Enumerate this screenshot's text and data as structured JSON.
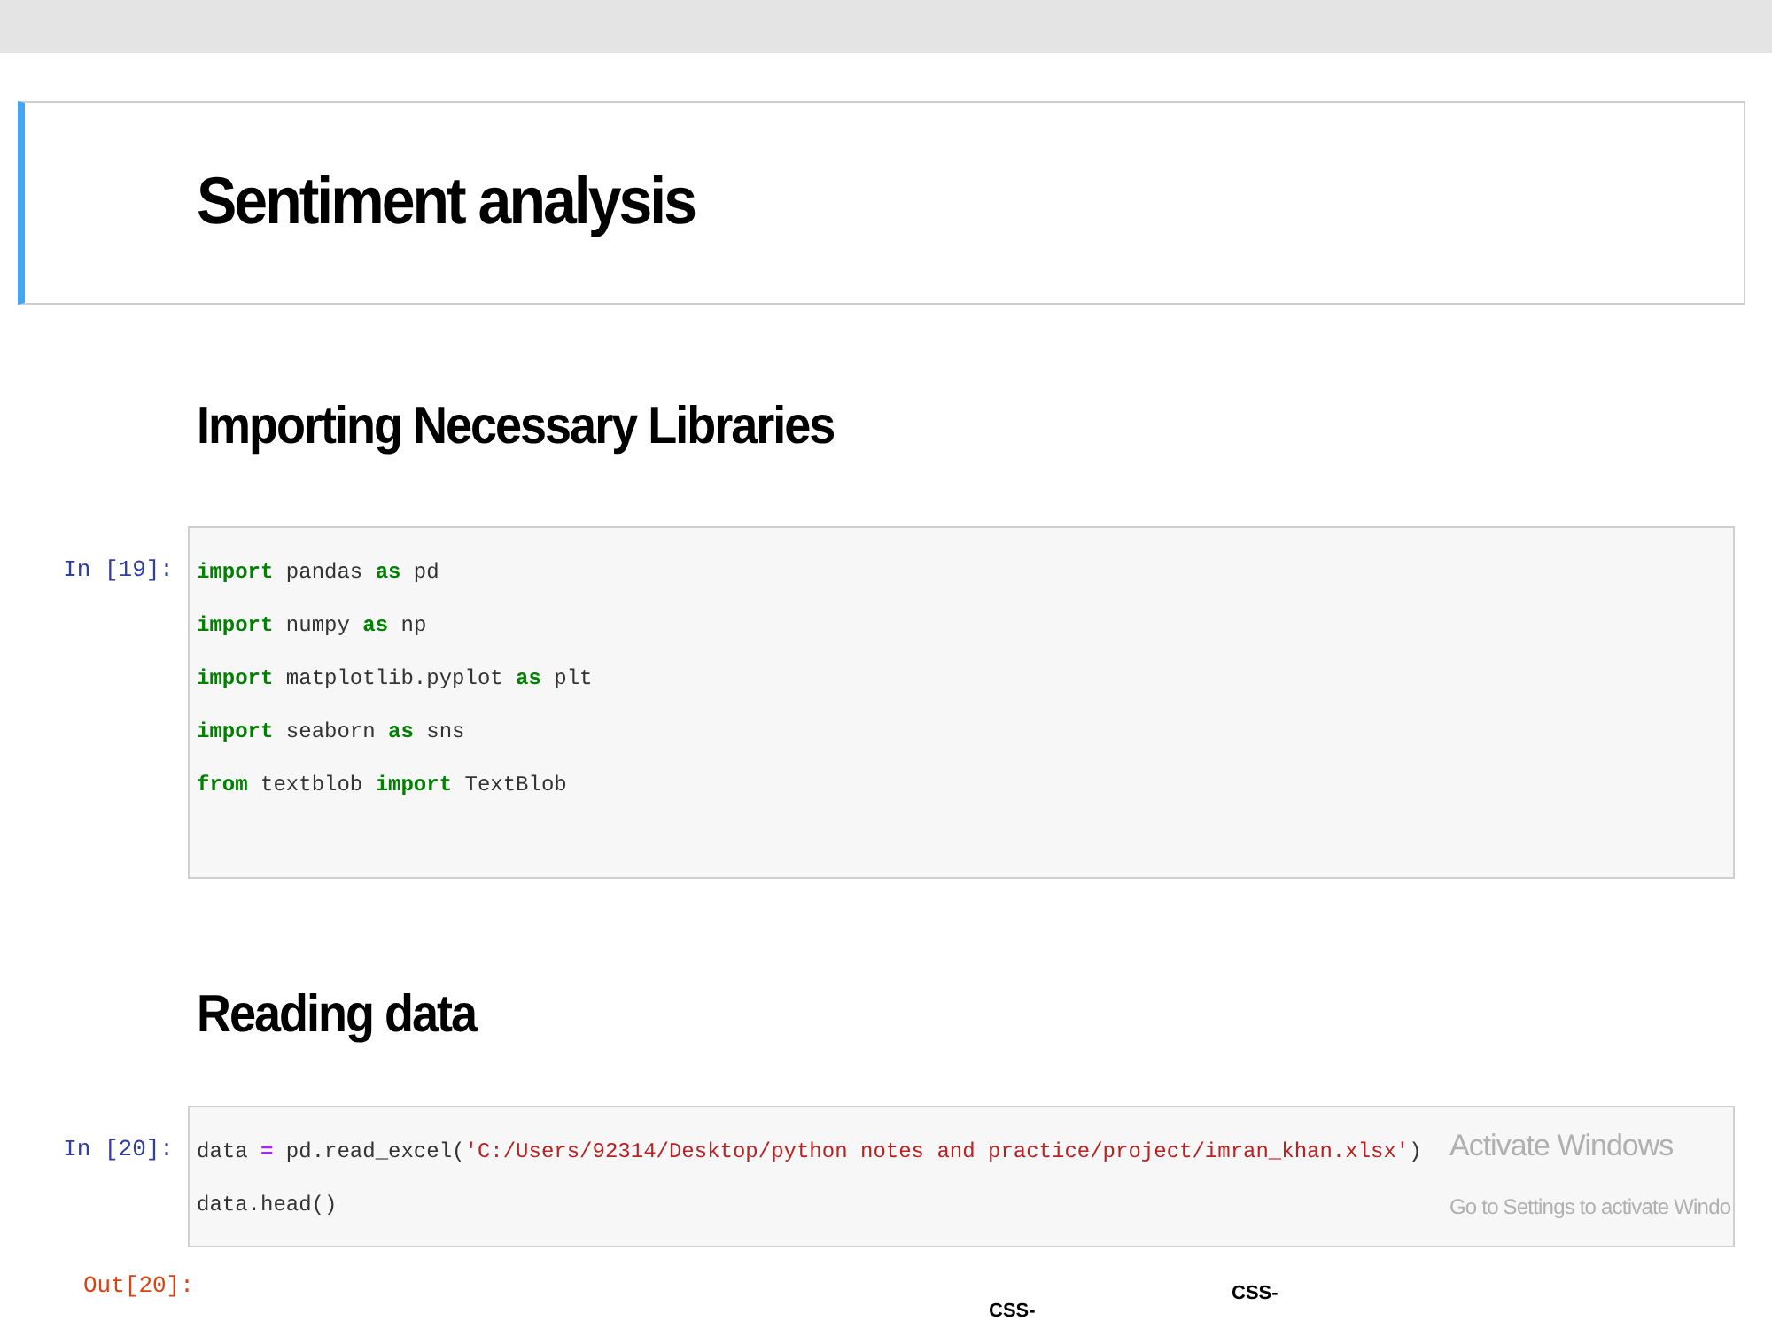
{
  "title_cell": {
    "title": "Sentiment analysis"
  },
  "sections": [
    {
      "heading": "Importing Necessary Libraries",
      "prompt": "In [19]:",
      "lines": [
        [
          {
            "kind": "keyword",
            "text": "import"
          },
          {
            "kind": "plain",
            "text": " pandas "
          },
          {
            "kind": "keyword",
            "text": "as"
          },
          {
            "kind": "plain",
            "text": " pd"
          }
        ],
        [
          {
            "kind": "keyword",
            "text": "import"
          },
          {
            "kind": "plain",
            "text": " numpy "
          },
          {
            "kind": "keyword",
            "text": "as"
          },
          {
            "kind": "plain",
            "text": " np"
          }
        ],
        [
          {
            "kind": "keyword",
            "text": "import"
          },
          {
            "kind": "plain",
            "text": " matplotlib.pyplot "
          },
          {
            "kind": "keyword",
            "text": "as"
          },
          {
            "kind": "plain",
            "text": " plt"
          }
        ],
        [
          {
            "kind": "keyword",
            "text": "import"
          },
          {
            "kind": "plain",
            "text": " seaborn "
          },
          {
            "kind": "keyword",
            "text": "as"
          },
          {
            "kind": "plain",
            "text": " sns"
          }
        ],
        [
          {
            "kind": "keyword",
            "text": "from"
          },
          {
            "kind": "plain",
            "text": " textblob "
          },
          {
            "kind": "keyword",
            "text": "import"
          },
          {
            "kind": "plain",
            "text": " TextBlob"
          }
        ]
      ]
    },
    {
      "heading": "Reading data",
      "prompt": "In [20]:",
      "lines": [
        [
          {
            "kind": "plain",
            "text": "data "
          },
          {
            "kind": "operator",
            "text": "="
          },
          {
            "kind": "plain",
            "text": " pd.read_excel("
          },
          {
            "kind": "string",
            "text": "'C:/Users/92314/Desktop/python notes and practice/project/imran_khan.xlsx'"
          },
          {
            "kind": "plain",
            "text": ")"
          }
        ],
        [
          {
            "kind": "plain",
            "text": "data.head()"
          }
        ]
      ]
    }
  ],
  "output": {
    "prompt": "Out[20]:",
    "column_headers": [
      "CSS-",
      "CSS-"
    ]
  },
  "overlay": {
    "title": "Activate Windows",
    "subtitle": "Go to Settings to activate Windo"
  }
}
